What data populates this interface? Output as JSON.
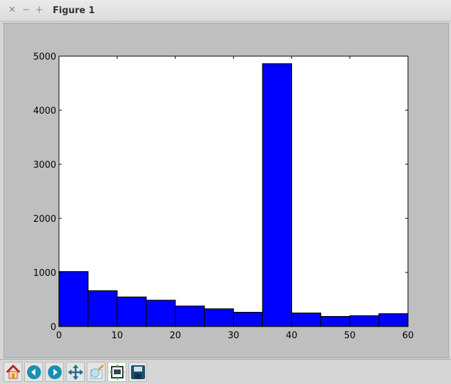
{
  "window": {
    "title": "Figure 1",
    "controls": [
      "close",
      "minimize",
      "maximize"
    ]
  },
  "toolbar": {
    "tools": [
      "home-icon",
      "back-icon",
      "forward-icon",
      "pan-icon",
      "zoom-icon",
      "subplots-icon",
      "save-icon"
    ]
  },
  "chart_data": {
    "type": "bar",
    "title": "",
    "xlabel": "",
    "ylabel": "",
    "bin_edges": [
      0,
      5,
      10,
      15,
      20,
      25,
      30,
      35,
      40,
      45,
      50,
      55,
      60
    ],
    "values": [
      1015,
      661,
      545,
      485,
      378,
      326,
      262,
      4860,
      249,
      185,
      198,
      236
    ],
    "xlim": [
      0,
      60
    ],
    "ylim": [
      0,
      5000
    ],
    "xticks": [
      "0",
      "10",
      "20",
      "30",
      "40",
      "50",
      "60"
    ],
    "yticks": [
      "0",
      "1000",
      "2000",
      "3000",
      "4000",
      "5000"
    ],
    "bar_color": "#0000ff",
    "grid": false
  }
}
